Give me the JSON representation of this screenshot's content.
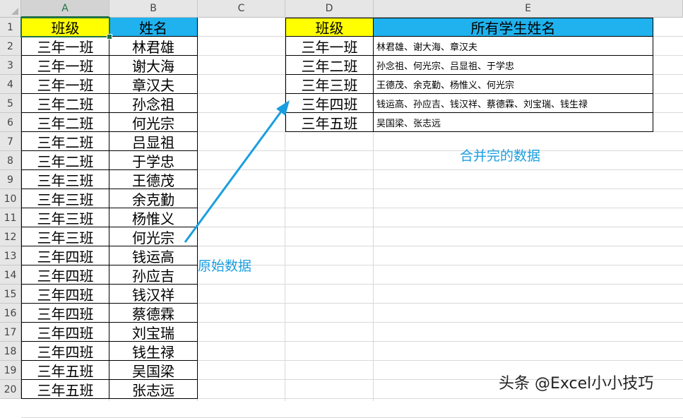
{
  "columns": [
    "A",
    "B",
    "C",
    "D",
    "E"
  ],
  "row_numbers": [
    "1",
    "2",
    "3",
    "4",
    "5",
    "6",
    "7",
    "8",
    "9",
    "10",
    "11",
    "12",
    "13",
    "14",
    "15",
    "16",
    "17",
    "18",
    "19",
    "20"
  ],
  "source_table": {
    "headers": [
      "班级",
      "姓名"
    ],
    "rows": [
      [
        "三年一班",
        "林君雄"
      ],
      [
        "三年一班",
        "谢大海"
      ],
      [
        "三年一班",
        "章汉夫"
      ],
      [
        "三年二班",
        "孙念祖"
      ],
      [
        "三年二班",
        "何光宗"
      ],
      [
        "三年二班",
        "吕显祖"
      ],
      [
        "三年二班",
        "于学忠"
      ],
      [
        "三年三班",
        "王德茂"
      ],
      [
        "三年三班",
        "余克勤"
      ],
      [
        "三年三班",
        "杨惟义"
      ],
      [
        "三年三班",
        "何光宗"
      ],
      [
        "三年四班",
        "钱运高"
      ],
      [
        "三年四班",
        "孙应吉"
      ],
      [
        "三年四班",
        "钱汉祥"
      ],
      [
        "三年四班",
        "蔡德霖"
      ],
      [
        "三年四班",
        "刘宝瑞"
      ],
      [
        "三年四班",
        "钱生禄"
      ],
      [
        "三年五班",
        "吴国梁"
      ],
      [
        "三年五班",
        "张志远"
      ]
    ]
  },
  "merged_table": {
    "headers": [
      "班级",
      "所有学生姓名"
    ],
    "rows": [
      [
        "三年一班",
        "林君雄、谢大海、章汉夫"
      ],
      [
        "三年二班",
        "孙念祖、何光宗、吕显祖、于学忠"
      ],
      [
        "三年三班",
        "王德茂、余克勤、杨惟义、何光宗"
      ],
      [
        "三年四班",
        "钱运高、孙应吉、钱汉祥、蔡德霖、刘宝瑞、钱生禄"
      ],
      [
        "三年五班",
        "吴国梁、张志远"
      ]
    ]
  },
  "annotations": {
    "original_label": "原始数据",
    "merged_label": "合并完的数据"
  },
  "watermark": "头条 @Excel小小技巧",
  "colors": {
    "header_yellow": "#ffff00",
    "header_blue": "#1fb2ee",
    "annotation_blue": "#1a9ee0",
    "selection_green": "#217346"
  }
}
